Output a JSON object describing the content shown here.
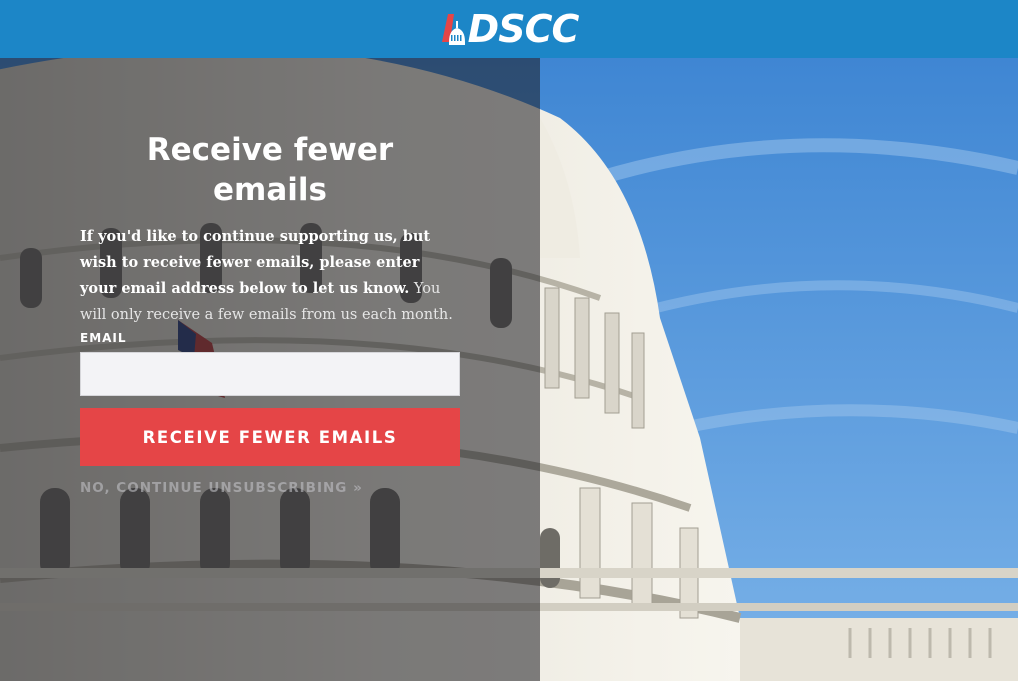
{
  "header": {
    "brand_text": "DSCC",
    "colors": {
      "bar": "#1c86c7",
      "logo_red": "#e54547",
      "logo_white": "#ffffff"
    }
  },
  "form": {
    "title": "Receive fewer emails",
    "description_bold": "If you'd like to continue supporting us, but wish to receive fewer emails, please enter your email address below to let us know.",
    "description_regular": " You will only receive a few emails from us each month.",
    "email_label": "EMAIL",
    "email_value": "",
    "email_placeholder": "",
    "submit_label": "RECEIVE FEWER EMAILS",
    "continue_label": "NO, CONTINUE UNSUBSCRIBING »",
    "colors": {
      "button": "#e54547",
      "overlay": "rgba(30,30,34,0.55)"
    }
  },
  "background": {
    "icon": "capitol-building-photo"
  }
}
